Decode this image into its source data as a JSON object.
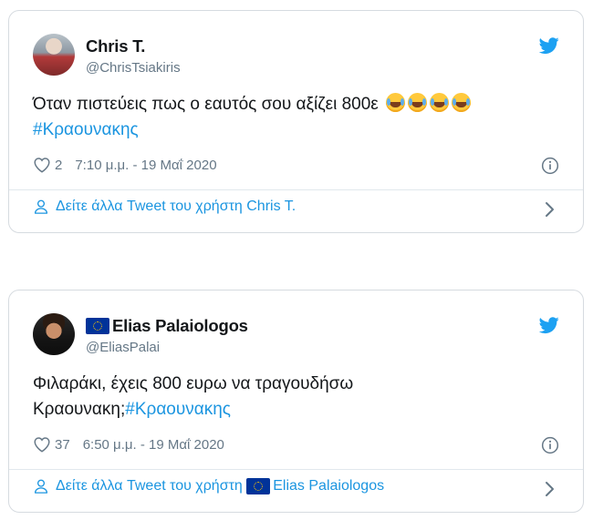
{
  "tweets": [
    {
      "display_name": "Chris T.",
      "handle": "@ChrisTsiakiris",
      "text_main": "Όταν πιστεύεις πως ο εαυτός σου αξίζει 800ε",
      "emoji_count": 4,
      "emoji_name": "face-with-tears-of-joy",
      "text_suffix": "",
      "hashtag": "#Κραουνακης",
      "likes": "2",
      "timestamp": "7:10 μ.μ. - 19 Μαΐ 2020",
      "more_prefix": "Δείτε άλλα Tweet του χρήστη",
      "more_name": "Chris T.",
      "has_flag": false
    },
    {
      "display_name": "Elias Palaiologos",
      "handle": "@EliasPalai",
      "text_main": "Φιλαράκι, έχεις 800 ευρω να τραγουδήσω",
      "text_line2": "Κραουνακη;",
      "hashtag": "#Κραουνακης",
      "likes": "37",
      "timestamp": "6:50 μ.μ. - 19 Μαΐ 2020",
      "more_prefix": "Δείτε άλλα Tweet του χρήστη",
      "more_name": "Elias Palaiologos",
      "has_flag": true
    }
  ],
  "colors": {
    "link": "#1b95e0",
    "muted": "#657786",
    "border": "#d6dbe0",
    "text": "#14171a"
  },
  "icons": {
    "brand": "twitter-bird-icon",
    "like": "heart-icon",
    "info": "info-icon",
    "profile": "person-icon",
    "chevron": "chevron-right-icon",
    "flag": "eu-flag-icon"
  }
}
